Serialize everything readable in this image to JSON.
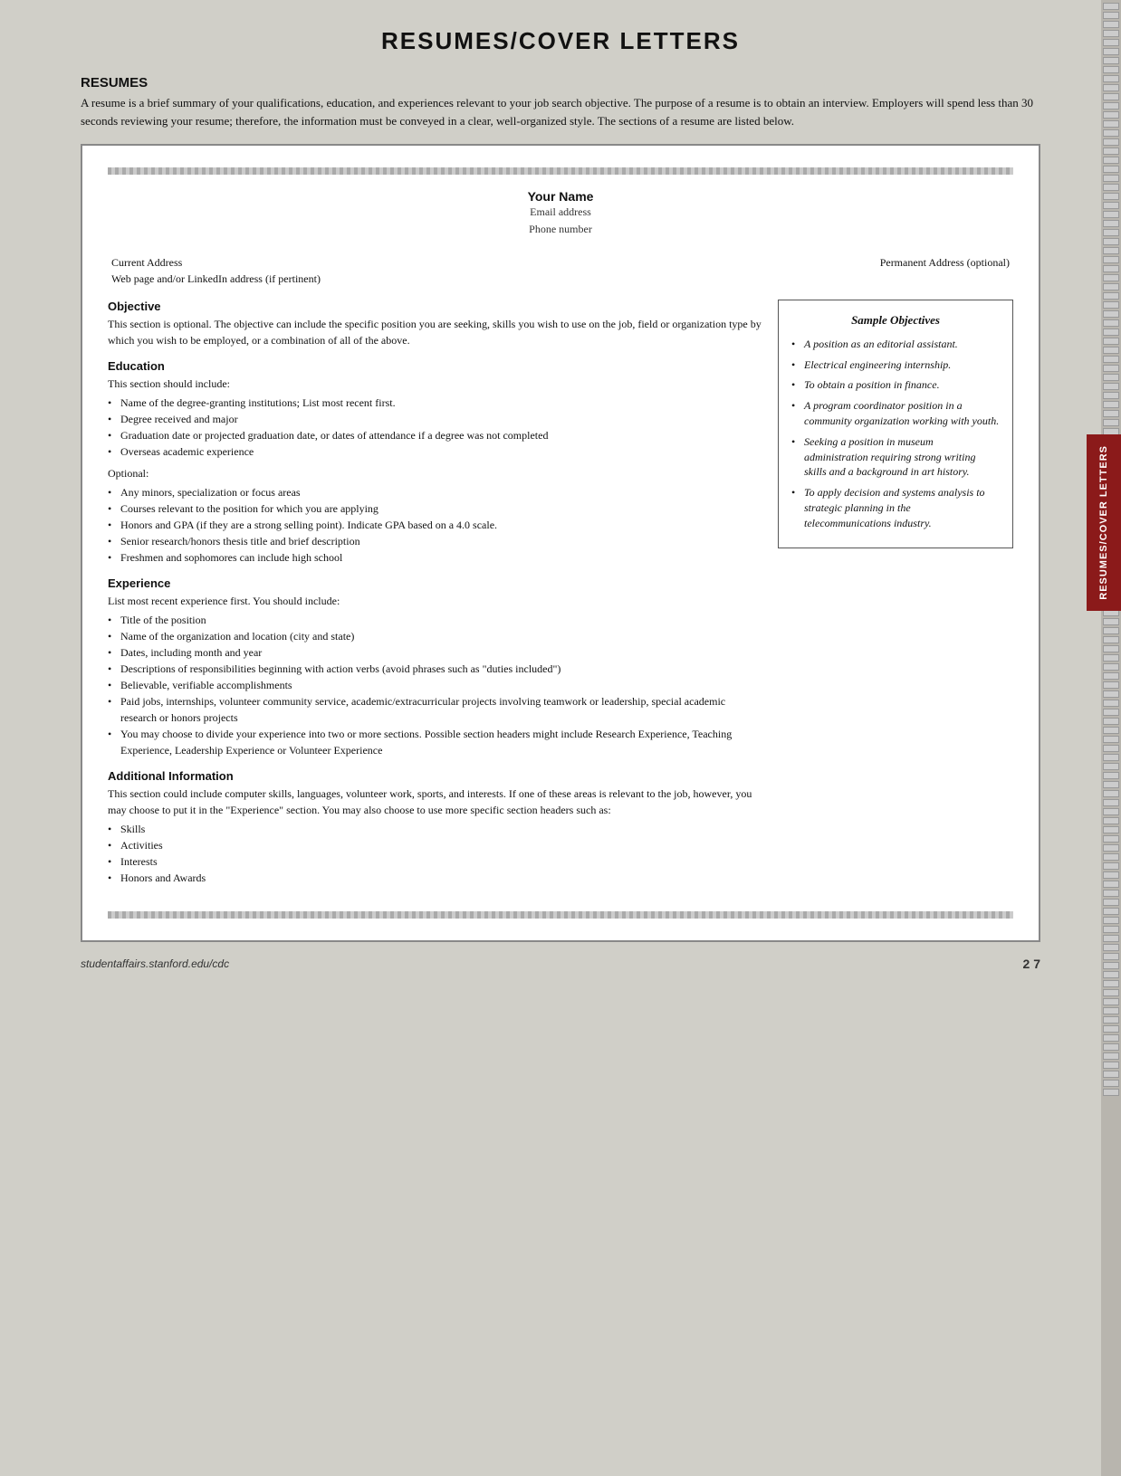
{
  "page": {
    "title": "RESUMES/COVER LETTERS",
    "side_tab": "RESUMES/COVER LETTERS",
    "footer": {
      "url": "studentaffairs.stanford.edu/cdc",
      "page": "2 7"
    }
  },
  "intro": {
    "heading": "RESUMES",
    "text": "A resume is a brief summary of your qualifications, education, and experiences relevant to your job search objective. The purpose of a resume is to obtain an interview. Employers will spend less than 30 seconds reviewing your resume; therefore, the information must be conveyed in a clear, well-organized style. The sections of a resume are listed below."
  },
  "resume_template": {
    "name": "Your Name",
    "email": "Email address",
    "phone": "Phone number",
    "address_left_line1": "Current Address",
    "address_left_line2": "Web page and/or LinkedIn address (if pertinent)",
    "address_right": "Permanent Address (optional)"
  },
  "sections": {
    "objective": {
      "title": "Objective",
      "text": "This section is optional. The objective can include the specific position you are seeking, skills you wish to use on the job, field or organization type by which you wish to be employed, or a combination of all of the above."
    },
    "education": {
      "title": "Education",
      "intro": "This section should include:",
      "items": [
        "Name of the degree-granting institutions; List most recent first.",
        "Degree received and major",
        "Graduation date or projected graduation date, or dates of attendance if a degree was not completed",
        "Overseas academic experience"
      ],
      "optional_label": "Optional:",
      "optional_items": [
        "Any minors, specialization or focus areas",
        "Courses relevant to the position for which you are applying",
        "Honors and GPA (if they are a strong selling point). Indicate GPA based on a 4.0 scale.",
        "Senior research/honors thesis title and brief description",
        "Freshmen and sophomores can include high school"
      ]
    },
    "experience": {
      "title": "Experience",
      "intro": "List most recent experience first. You should include:",
      "items": [
        "Title of the position",
        "Name of the organization and location (city and state)",
        "Dates, including month and year",
        "Descriptions of responsibilities beginning with action verbs (avoid phrases such as \"duties included\")",
        "Believable, verifiable accomplishments",
        "Paid jobs, internships, volunteer community service, academic/extracurricular projects involving teamwork or leadership, special academic research or honors projects",
        "You may choose to divide your experience into two or more sections. Possible section headers might include Research Experience, Teaching Experience, Leadership Experience or Volunteer Experience"
      ]
    },
    "additional": {
      "title": "Additional Information",
      "text": "This section could include computer skills, languages, volunteer work, sports, and interests. If one of these areas is relevant to the job, however, you may choose to put it in the \"Experience\" section. You may also choose to use more specific section headers such as:",
      "items": [
        "Skills",
        "Activities",
        "Interests",
        "Honors and Awards"
      ]
    }
  },
  "sample_objectives": {
    "title": "Sample Objectives",
    "items": [
      "A position as an editorial assistant.",
      "Electrical engineering internship.",
      "To obtain a position in finance.",
      "A program coordinator position in a community organization working with youth.",
      "Seeking a position in museum administration requiring strong writing skills and a background in art history.",
      "To apply decision and systems analysis to strategic planning in the telecommunications industry."
    ]
  }
}
